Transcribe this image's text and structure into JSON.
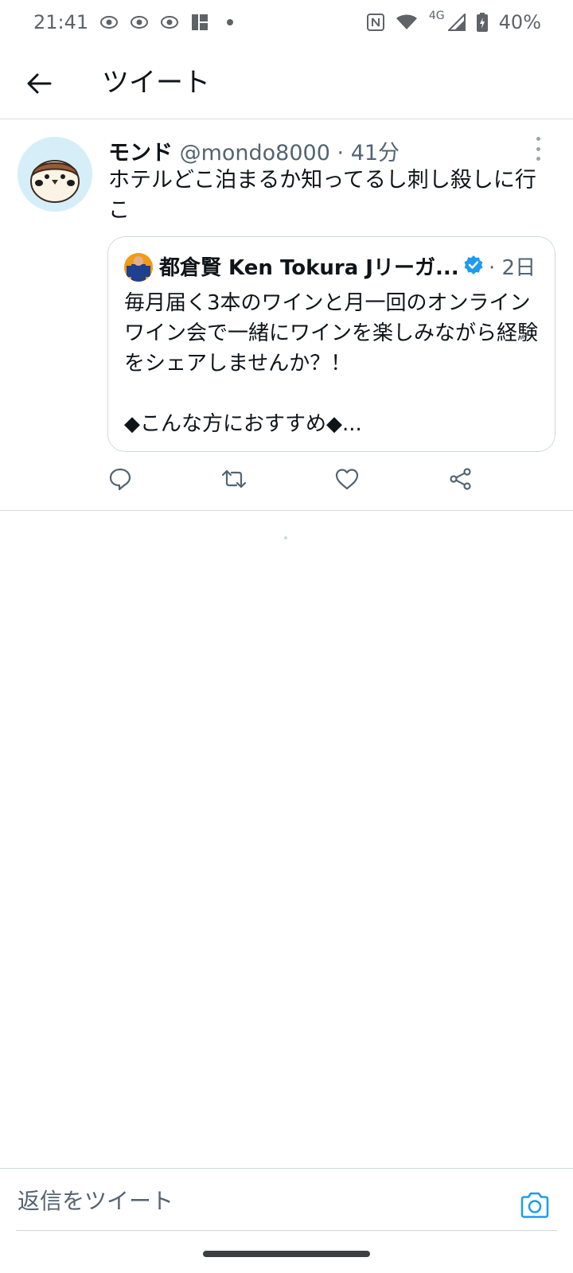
{
  "status_bar": {
    "time": "21:41",
    "network_label": "4G",
    "battery_percent": "40%",
    "left_icons": [
      "notification-eye-icon",
      "notification-eye-icon",
      "notification-eye-icon",
      "app-notification-icon",
      "more-notifications-dot"
    ],
    "right_icons": [
      "nfc-icon",
      "wifi-icon",
      "signal-icon",
      "battery-charging-icon"
    ]
  },
  "appbar": {
    "title": "ツイート",
    "back_icon": "arrow-left-icon"
  },
  "tweet": {
    "author_name": "モンド",
    "author_handle": "@mondo8000",
    "separator": "·",
    "time": "41分",
    "text": "ホテルどこ泊まるか知ってるし刺し殺しに行こ",
    "quote": {
      "author_name": "都倉賢 Ken Tokura Jリーガ...",
      "verified": true,
      "separator": "·",
      "time": "2日",
      "text": "毎月届く3本のワインと月一回のオンラインワイン会で一緒にワインを楽しみながら経験をシェアしませんか？！\n\n◆こんな方におすすめ◆..."
    },
    "actions": [
      "reply-icon",
      "retweet-icon",
      "like-icon",
      "share-icon"
    ]
  },
  "reply": {
    "placeholder": "返信をツイート",
    "camera_icon": "camera-icon"
  },
  "colors": {
    "accent": "#1d9bf0",
    "text_primary": "#0f1419",
    "text_secondary": "#536471",
    "divider": "#cfd9de"
  }
}
